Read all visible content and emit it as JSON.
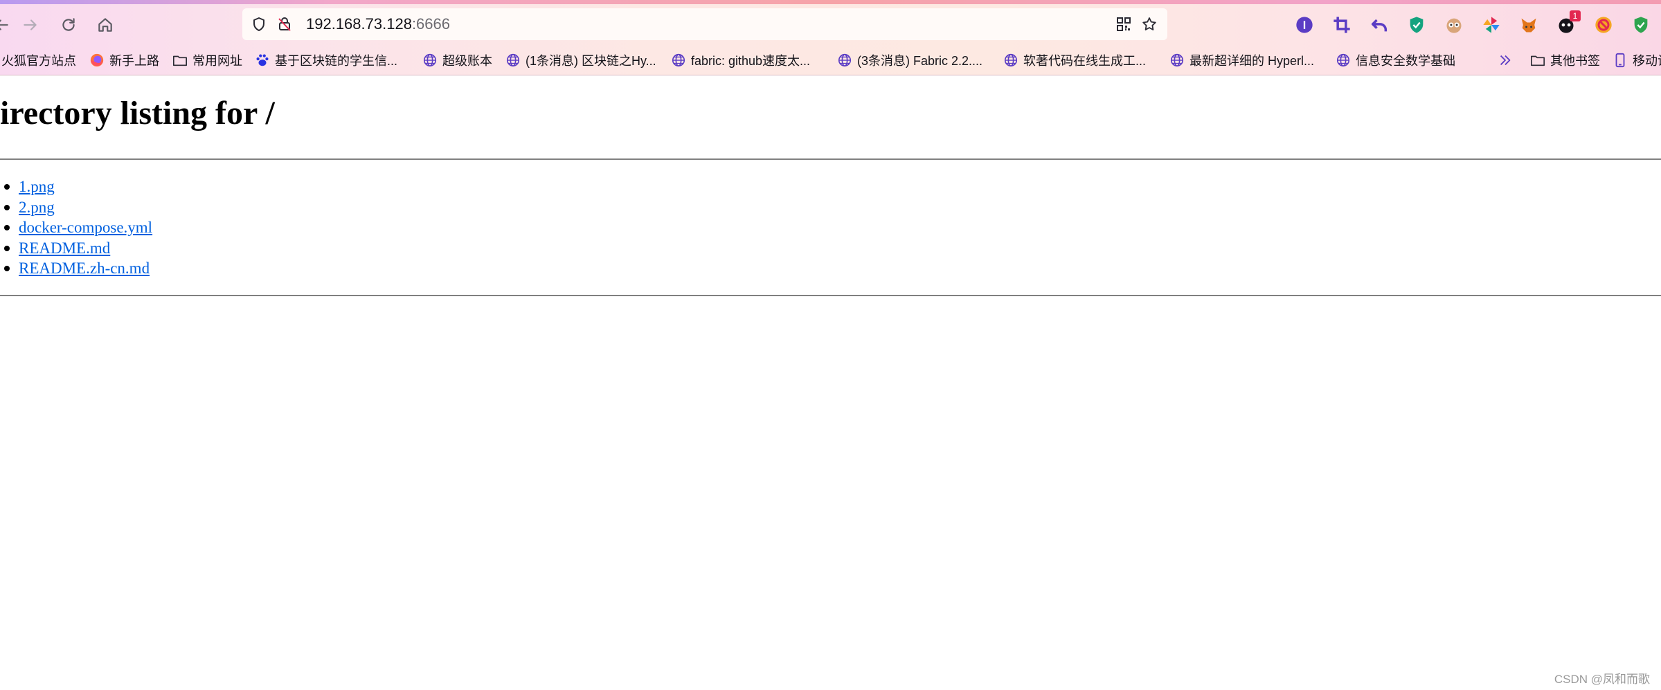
{
  "browser": {
    "url_host": "192.168.73.128",
    "url_port": ":6666",
    "colors": {
      "accent": "#5b3cc4",
      "link": "#0060df"
    },
    "extension_badge": "1",
    "bookmarks": [
      {
        "label": "火狐官方站点",
        "icon": "none"
      },
      {
        "label": "新手上路",
        "icon": "firefox-icon"
      },
      {
        "label": "常用网址",
        "icon": "folder-icon"
      },
      {
        "label": "基于区块链的学生信...",
        "icon": "baidu-paw-icon"
      },
      {
        "label": "超级账本",
        "icon": "globe-icon"
      },
      {
        "label": "(1条消息) 区块链之Hy...",
        "icon": "globe-icon"
      },
      {
        "label": "fabric: github速度太...",
        "icon": "globe-icon"
      },
      {
        "label": "(3条消息) Fabric 2.2....",
        "icon": "globe-icon"
      },
      {
        "label": "软著代码在线生成工...",
        "icon": "globe-icon"
      },
      {
        "label": "最新超详细的 Hyperl...",
        "icon": "globe-icon"
      },
      {
        "label": "信息安全数学基础",
        "icon": "globe-icon"
      },
      {
        "label": "其他书签",
        "icon": "folder-icon"
      },
      {
        "label": "移动设",
        "icon": "mobile-icon"
      }
    ]
  },
  "page": {
    "title": "irectory listing for /",
    "files": [
      "1.png",
      "2.png",
      "docker-compose.yml",
      "README.md",
      "README.zh-cn.md"
    ]
  },
  "watermark": "CSDN @凤和而歌"
}
